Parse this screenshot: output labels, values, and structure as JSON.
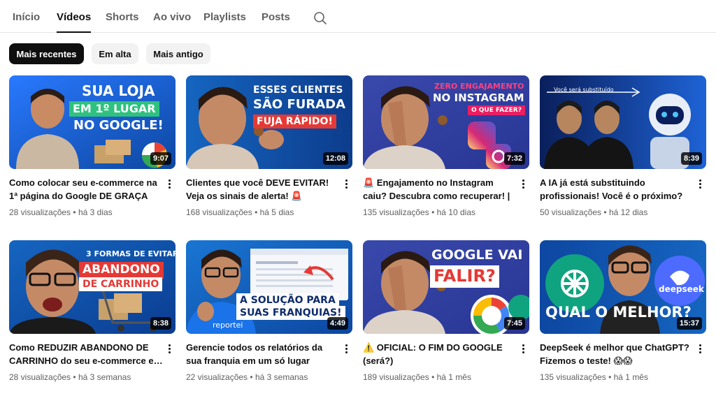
{
  "tabs": [
    {
      "label": "Início"
    },
    {
      "label": "Vídeos"
    },
    {
      "label": "Shorts"
    },
    {
      "label": "Ao vivo"
    },
    {
      "label": "Playlists"
    },
    {
      "label": "Posts"
    }
  ],
  "active_tab": "Vídeos",
  "search_icon": "search-icon",
  "chips": [
    {
      "label": "Mais recentes",
      "active": true
    },
    {
      "label": "Em alta",
      "active": false
    },
    {
      "label": "Mais antigo",
      "active": false
    }
  ],
  "videos": [
    {
      "title": "Como colocar seu e-commerce na 1ª página do Google DE GRAÇA",
      "views": "28 visualizações",
      "age": "há 3 dias",
      "duration": "9:07",
      "overlay": [
        "SUA LOJA",
        "EM 1º LUGAR",
        "NO GOOGLE!"
      ]
    },
    {
      "title": "Clientes que você DEVE EVITAR! Veja os sinais de alerta! 🚨",
      "views": "168 visualizações",
      "age": "há 5 dias",
      "duration": "12:08",
      "overlay": [
        "ESSES CLIENTES",
        "SÃO FURADA",
        "FUJA RÁPIDO!"
      ]
    },
    {
      "title": "🚨 Engajamento no Instagram caiu? Descubra como recuperar! | Como…",
      "views": "135 visualizações",
      "age": "há 10 dias",
      "duration": "7:32",
      "overlay": [
        "ZERO ENGAJAMENTO",
        "NO INSTAGRAM",
        "O QUE FAZER?"
      ]
    },
    {
      "title": "A IA já está substituindo profissionais! Você é o próximo? (…",
      "views": "50 visualizações",
      "age": "há 12 dias",
      "duration": "8:39",
      "overlay": [
        "Você será substituído"
      ]
    },
    {
      "title": "Como REDUZIR ABANDONO DE CARRINHO do seu e-commerce e…",
      "views": "28 visualizações",
      "age": "há 3 semanas",
      "duration": "8:38",
      "overlay": [
        "3 FORMAS DE EVITAR",
        "ABANDONO",
        "DE CARRINHO"
      ]
    },
    {
      "title": "Gerencie todos os relatórios da sua franquia em um só lugar com…",
      "views": "22 visualizações",
      "age": "há 3 semanas",
      "duration": "4:49",
      "overlay": [
        "A SOLUÇÃO PARA",
        "SUAS FRANQUIAS!",
        "reportei"
      ]
    },
    {
      "title": "⚠️ OFICIAL: O FIM DO GOOGLE (será?)",
      "views": "189 visualizações",
      "age": "há 1 mês",
      "duration": "7:45",
      "overlay": [
        "GOOGLE VAI",
        "FALIR?"
      ]
    },
    {
      "title": "DeepSeek é melhor que ChatGPT? Fizemos o teste! 😱😱",
      "views": "135 visualizações",
      "age": "há 1 mês",
      "duration": "15:37",
      "overlay": [
        "deepseek",
        "QUAL O MELHOR?"
      ]
    }
  ],
  "meta_separator": "•",
  "colors": {
    "text_primary": "#0f0f0f",
    "text_secondary": "#606060",
    "chip_bg": "#f2f2f2",
    "chip_active_bg": "#0f0f0f",
    "green": "#2ec27e",
    "red": "#e53935",
    "blue": "#1e63d6",
    "pink": "#e91e63"
  }
}
